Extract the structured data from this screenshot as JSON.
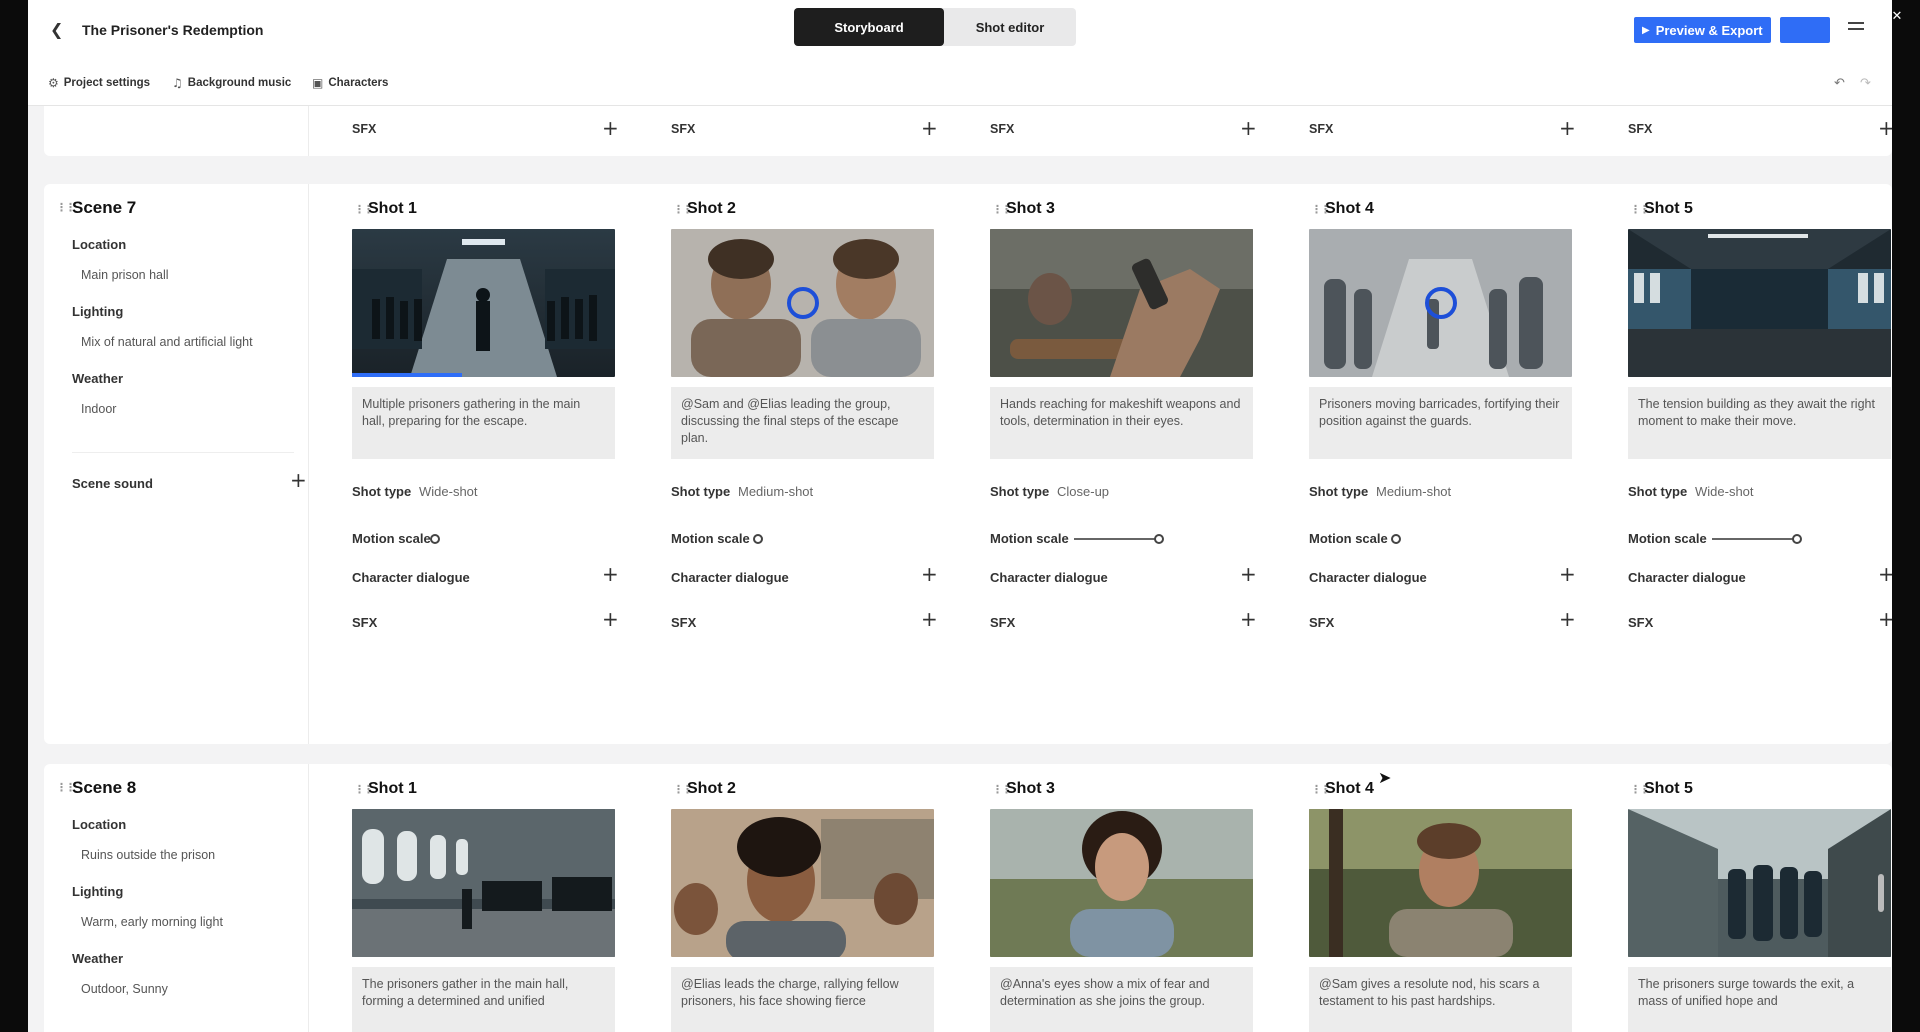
{
  "header": {
    "project_title": "The Prisoner's Redemption",
    "tabs": [
      {
        "label": "Storyboard",
        "active": true
      },
      {
        "label": "Shot editor",
        "active": false
      }
    ],
    "export_label": "Preview & Export"
  },
  "toolbar": {
    "project_settings": "Project settings",
    "background_music": "Background music",
    "characters": "Characters"
  },
  "top_strip": {
    "sfx_label": "SFX"
  },
  "labels": {
    "location": "Location",
    "lighting": "Lighting",
    "weather": "Weather",
    "scene_sound": "Scene sound",
    "shot_type": "Shot type",
    "motion_scale": "Motion scale",
    "character_dialogue": "Character dialogue",
    "sfx": "SFX"
  },
  "scene7": {
    "title": "Scene 7",
    "location": "Main prison hall",
    "lighting": "Mix of natural and artificial light",
    "weather": "Indoor",
    "shots": [
      {
        "title": "Shot 1",
        "description": "Multiple prisoners gathering in the main hall, preparing for the escape.",
        "shot_type": "Wide-shot",
        "motion": 0.0
      },
      {
        "title": "Shot 2",
        "description": "@Sam and @Elias leading the group, discussing the final steps of the escape plan.",
        "shot_type": "Medium-shot",
        "motion": 0.0
      },
      {
        "title": "Shot 3",
        "description": "Hands reaching for makeshift weapons and tools, determination in their eyes.",
        "shot_type": "Close-up",
        "motion": 0.85
      },
      {
        "title": "Shot 4",
        "description": "Prisoners moving barricades, fortifying their position against the guards.",
        "shot_type": "Medium-shot",
        "motion": 0.0
      },
      {
        "title": "Shot 5",
        "description": "The tension building as they await the right moment to make their move.",
        "shot_type": "Wide-shot",
        "motion": 0.85
      }
    ]
  },
  "scene8": {
    "title": "Scene 8",
    "location": "Ruins outside the prison",
    "lighting": "Warm, early morning light",
    "weather": "Outdoor, Sunny",
    "shots": [
      {
        "title": "Shot 1",
        "description": "The prisoners gather in the main hall, forming a determined and unified"
      },
      {
        "title": "Shot 2",
        "description": "@Elias leads the charge, rallying fellow prisoners, his face showing fierce"
      },
      {
        "title": "Shot 3",
        "description": "@Anna's eyes show a mix of fear and determination as she joins the group."
      },
      {
        "title": "Shot 4",
        "description": "@Sam gives a resolute nod, his scars a testament to his past hardships."
      },
      {
        "title": "Shot 5",
        "description": "The prisoners surge towards the exit, a mass of unified hope and"
      }
    ]
  }
}
